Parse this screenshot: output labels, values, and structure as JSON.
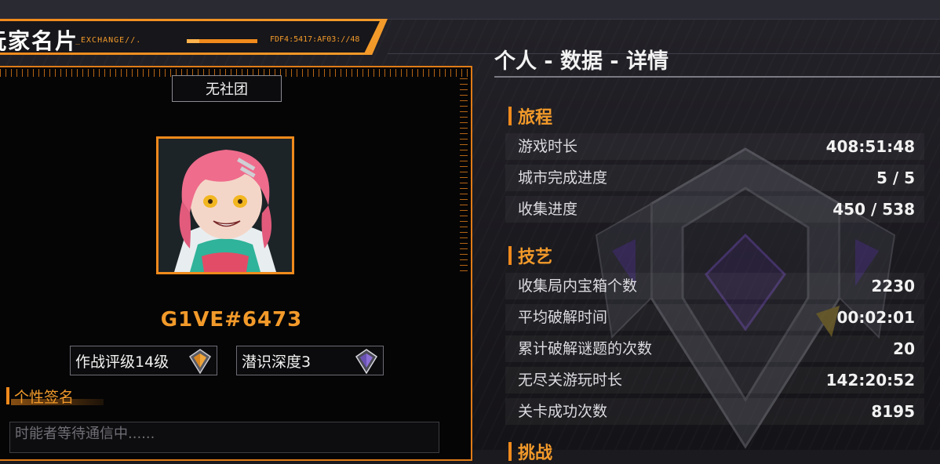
{
  "header": {
    "title": "玩家名片",
    "subtitle": "_EXCHANGE//.",
    "code": "FDF4:5417:AF03://48"
  },
  "card": {
    "club": "无社团",
    "player_name": "G1VE#6473",
    "badges": [
      {
        "label": "作战评级14级",
        "icon": "rank-diamond-icon"
      },
      {
        "label": "潜识深度3",
        "icon": "depth-crystal-icon"
      }
    ],
    "signature_label": "个性签名",
    "signature_placeholder": "时能者等待通信中......"
  },
  "stats": {
    "title": "个人 - 数据 - 详情",
    "sections": [
      {
        "name": "旅程",
        "rows": [
          {
            "label": "游戏时长",
            "value": "408:51:48"
          },
          {
            "label": "城市完成进度",
            "value": "5 / 5"
          },
          {
            "label": "收集进度",
            "value": "450 / 538"
          }
        ]
      },
      {
        "name": "技艺",
        "rows": [
          {
            "label": "收集局内宝箱个数",
            "value": "2230"
          },
          {
            "label": "平均破解时间",
            "value": "00:02:01"
          },
          {
            "label": "累计破解谜题的次数",
            "value": "20"
          },
          {
            "label": "无尽关游玩时长",
            "value": "142:20:52"
          },
          {
            "label": "关卡成功次数",
            "value": "8195"
          }
        ]
      },
      {
        "name": "挑战",
        "rows": []
      }
    ]
  },
  "colors": {
    "accent": "#f08a1c",
    "background": "#1b1a1f",
    "card": "#050506"
  }
}
